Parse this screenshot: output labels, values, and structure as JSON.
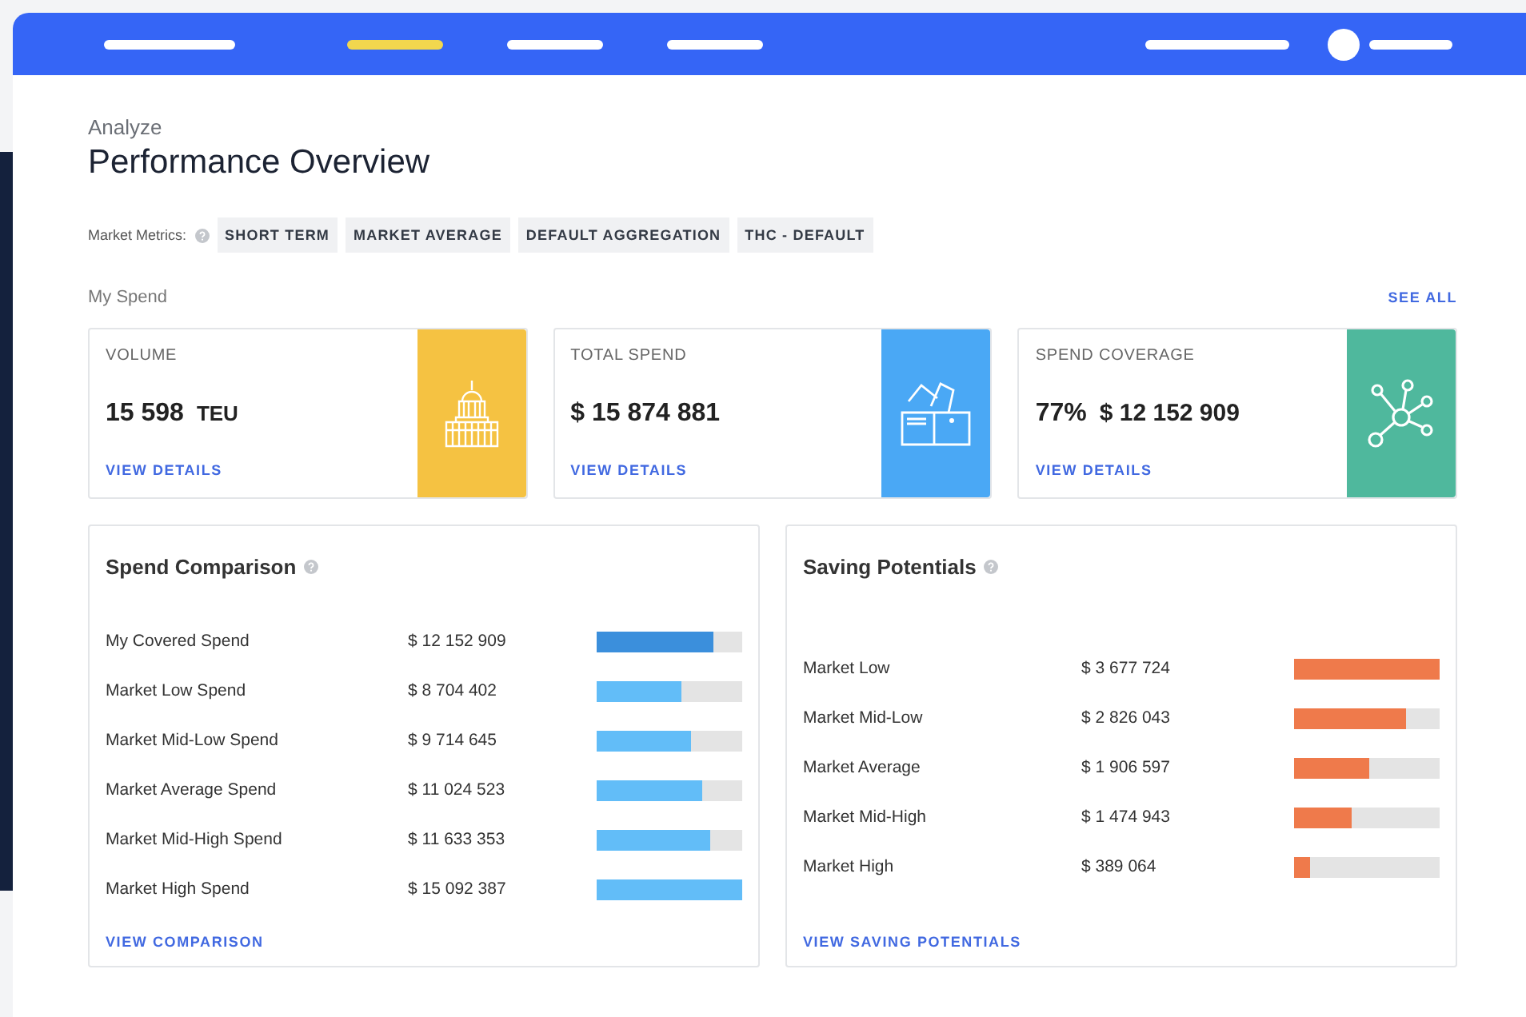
{
  "nav": {
    "items": [
      {
        "selected": false
      },
      {
        "selected": true
      },
      {
        "selected": false
      },
      {
        "selected": false
      }
    ]
  },
  "header": {
    "breadcrumb": "Analyze",
    "title": "Performance Overview"
  },
  "market_metrics": {
    "label": "Market Metrics:",
    "chips": [
      "SHORT TERM",
      "MARKET AVERAGE",
      "DEFAULT AGGREGATION",
      "THC - DEFAULT"
    ]
  },
  "my_spend": {
    "title": "My Spend",
    "see_all": "SEE ALL",
    "cards": [
      {
        "kind": "container",
        "label": "VOLUME",
        "value": "15 598",
        "unit": "TEU",
        "link": "VIEW DETAILS",
        "color": "#f5c242"
      },
      {
        "kind": "wallet",
        "label": "TOTAL SPEND",
        "value": "$ 15 874 881",
        "link": "VIEW DETAILS",
        "color": "#4aa8f5"
      },
      {
        "kind": "network",
        "label": "SPEND COVERAGE",
        "value": "77%",
        "unit": "$ 12 152 909",
        "link": "VIEW DETAILS",
        "color": "#4fb89d"
      }
    ]
  },
  "spend_comparison": {
    "title": "Spend Comparison",
    "link": "VIEW COMPARISON",
    "rows": [
      {
        "label": "My Covered Spend",
        "amount": "$ 12 152 909",
        "level": 0.8,
        "color": "#3b8fdc"
      },
      {
        "label": "Market Low Spend",
        "amount": "$ 8 704 402",
        "level": 0.58,
        "color": "#62bdf8"
      },
      {
        "label": "Market Mid-Low Spend",
        "amount": "$ 9 714 645",
        "level": 0.65,
        "color": "#62bdf8"
      },
      {
        "label": "Market Average Spend",
        "amount": "$ 11 024 523",
        "level": 0.73,
        "color": "#62bdf8"
      },
      {
        "label": "Market Mid-High Spend",
        "amount": "$ 11 633 353",
        "level": 0.78,
        "color": "#62bdf8"
      },
      {
        "label": "Market High Spend",
        "amount": "$ 15 092 387",
        "level": 1.0,
        "color": "#62bdf8"
      }
    ]
  },
  "saving_potentials": {
    "title": "Saving Potentials",
    "link": "VIEW SAVING POTENTIALS",
    "rows": [
      {
        "label": "Market Low",
        "amount": "$ 3 677 724",
        "level": 1.0
      },
      {
        "label": "Market Mid-Low",
        "amount": "$ 2 826 043",
        "level": 0.77
      },
      {
        "label": "Market Average",
        "amount": "$ 1 906 597",
        "level": 0.52
      },
      {
        "label": "Market Mid-High",
        "amount": "$ 1 474 943",
        "level": 0.4
      },
      {
        "label": "Market High",
        "amount": "$ 389 064",
        "level": 0.11
      }
    ]
  }
}
